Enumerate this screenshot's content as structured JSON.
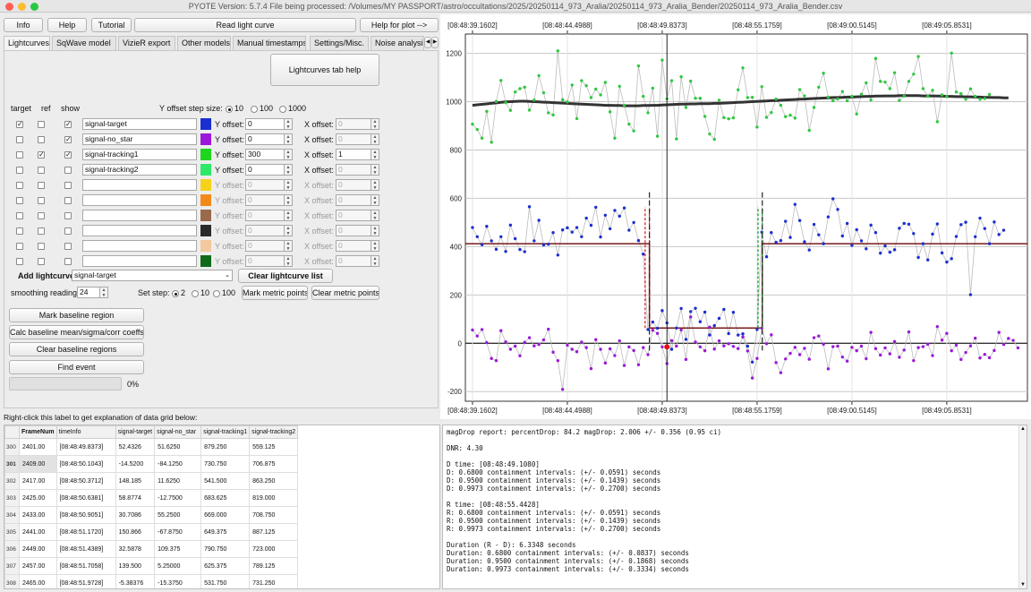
{
  "window": {
    "title": "PYOTE Version: 5.7.4  File being processed: /Volumes/MY PASSPORT/astro/occultations/2025/20250114_973_Aralia/20250114_973_Aralia_Bender/20250114_973_Aralia_Bender.csv"
  },
  "toolbar": {
    "info": "Info",
    "help": "Help",
    "tutorial": "Tutorial",
    "read_light_curve": "Read light curve",
    "help_for_plot": "Help for plot -->"
  },
  "tabs": [
    {
      "label": "Lightcurves",
      "active": true
    },
    {
      "label": "SqWave model",
      "active": false
    },
    {
      "label": "VizieR export",
      "active": false
    },
    {
      "label": "Other models",
      "active": false
    },
    {
      "label": "Manual timestamps",
      "active": false
    },
    {
      "label": "Settings/Misc.",
      "active": false
    },
    {
      "label": "Noise analysis/",
      "active": false
    }
  ],
  "tab_scroll": {
    "left": "◀",
    "right": "▶"
  },
  "lightcurves": {
    "tab_help": "Lightcurves tab help",
    "y_step_label": "Y offset step size:",
    "y_step_options": [
      "10",
      "100",
      "1000"
    ],
    "y_step_selected": "10",
    "headers": {
      "target": "target",
      "ref": "ref",
      "show": "show"
    },
    "y_offset_label": "Y offset:",
    "x_offset_label": "X offset:",
    "rows": [
      {
        "name": "signal-target",
        "color": "#1a2fd0",
        "target": true,
        "ref": false,
        "show": true,
        "y": "0",
        "x": "0",
        "enabled": true,
        "x_enabled": false
      },
      {
        "name": "signal-no_star",
        "color": "#9b18d8",
        "target": false,
        "ref": false,
        "show": true,
        "y": "0",
        "x": "0",
        "enabled": true,
        "x_enabled": false
      },
      {
        "name": "signal-tracking1",
        "color": "#1fd51f",
        "target": false,
        "ref": true,
        "show": true,
        "y": "300",
        "x": "1",
        "enabled": true,
        "x_enabled": true
      },
      {
        "name": "signal-tracking2",
        "color": "#2ee86a",
        "target": false,
        "ref": false,
        "show": false,
        "y": "0",
        "x": "0",
        "enabled": true,
        "x_enabled": false
      },
      {
        "name": "",
        "color": "#f6d21a",
        "target": false,
        "ref": false,
        "show": false,
        "y": "0",
        "x": "0",
        "enabled": false,
        "x_enabled": false
      },
      {
        "name": "",
        "color": "#f28a1a",
        "target": false,
        "ref": false,
        "show": false,
        "y": "0",
        "x": "0",
        "enabled": false,
        "x_enabled": false
      },
      {
        "name": "",
        "color": "#9b6a4b",
        "target": false,
        "ref": false,
        "show": false,
        "y": "0",
        "x": "0",
        "enabled": false,
        "x_enabled": false
      },
      {
        "name": "",
        "color": "#2a2a2a",
        "target": false,
        "ref": false,
        "show": false,
        "y": "0",
        "x": "0",
        "enabled": false,
        "x_enabled": false
      },
      {
        "name": "",
        "color": "#f4c89c",
        "target": false,
        "ref": false,
        "show": false,
        "y": "0",
        "x": "0",
        "enabled": false,
        "x_enabled": false
      },
      {
        "name": "",
        "color": "#0f6a1a",
        "target": false,
        "ref": false,
        "show": false,
        "y": "0",
        "x": "0",
        "enabled": false,
        "x_enabled": false
      }
    ],
    "add_lightcurve_label": "Add lightcurve",
    "add_lightcurve_value": "signal-target",
    "clear_list": "Clear lightcurve list",
    "smoothing_label": "smoothing readings",
    "smoothing_value": "24",
    "set_step_label": "Set step:",
    "set_step_options": [
      "2",
      "10",
      "100"
    ],
    "set_step_selected": "2",
    "mark_metric": "Mark metric points",
    "clear_metric": "Clear metric points",
    "mark_baseline": "Mark baseline region",
    "calc_baseline": "Calc baseline mean/sigma/corr coeffs",
    "clear_baseline": "Clear baseline regions",
    "find_event": "Find event",
    "progress": "0%",
    "progress_value": 0
  },
  "grid_hint": "Right-click this label to get explanation of data grid below:",
  "grid": {
    "columns": [
      "FrameNum",
      "timeInfo",
      "signal-target",
      "signal-no_star",
      "signal-tracking1",
      "signal-tracking2"
    ],
    "rows": [
      {
        "idx": "300",
        "cells": [
          "2401.00",
          "[08:48:49.8373]",
          "52.4326",
          "51.6250",
          "879.250",
          "559.125"
        ]
      },
      {
        "idx": "301",
        "cells": [
          "2409.00",
          "[08:48:50.1043]",
          "-14.5200",
          "-84.1250",
          "730.750",
          "706.875"
        ],
        "selected": true
      },
      {
        "idx": "302",
        "cells": [
          "2417.00",
          "[08:48:50.3712]",
          "148.185",
          "11.6250",
          "541.500",
          "863.250"
        ]
      },
      {
        "idx": "303",
        "cells": [
          "2425.00",
          "[08:48:50.6381]",
          "58.8774",
          "-12.7500",
          "683.625",
          "819.000"
        ]
      },
      {
        "idx": "304",
        "cells": [
          "2433.00",
          "[08:48:50.9051]",
          "30.7086",
          "55.2500",
          "669.000",
          "708.750"
        ]
      },
      {
        "idx": "305",
        "cells": [
          "2441.00",
          "[08:48:51.1720]",
          "150.866",
          "-67.8750",
          "649.375",
          "887.125"
        ]
      },
      {
        "idx": "306",
        "cells": [
          "2449.00",
          "[08:48:51.4389]",
          "32.5878",
          "109.375",
          "790.750",
          "723.000"
        ]
      },
      {
        "idx": "307",
        "cells": [
          "2457.00",
          "[08:48:51.7058]",
          "139.500",
          "5.25000",
          "625.375",
          "789.125"
        ]
      },
      {
        "idx": "308",
        "cells": [
          "2465.00",
          "[08:48:51.9728]",
          "-5.38376",
          "-15.3750",
          "531.750",
          "731.250"
        ]
      }
    ]
  },
  "report_lines": [
    "magDrop report: percentDrop: 84.2 magDrop: 2.006 +/- 0.356 (0.95 ci)",
    "",
    "DNR: 4.30",
    "",
    "D time: [08:48:49.1080]",
    "D: 0.6800 containment intervals: (+/- 0.0591) seconds",
    "D: 0.9500 containment intervals: (+/- 0.1439) seconds",
    "D: 0.9973 containment intervals: (+/- 0.2700) seconds",
    "",
    "R time: [08:48:55.4428]",
    "R: 0.6800 containment intervals: (+/- 0.0591) seconds",
    "R: 0.9500 containment intervals: (+/- 0.1439) seconds",
    "R: 0.9973 containment intervals: (+/- 0.2700) seconds",
    "",
    "Duration (R - D): 6.3348 seconds",
    "Duration: 0.6800 containment intervals: (+/- 0.0837) seconds",
    "Duration: 0.9500 containment intervals: (+/- 0.1868) seconds",
    "Duration: 0.9973 containment intervals: (+/- 0.3334) seconds"
  ],
  "chart_data": {
    "type": "scatter",
    "title": "",
    "xlabel": "",
    "ylabel": "",
    "grid": true,
    "x_tick_labels": [
      "[08:48:39.1602]",
      "[08:48:44.4988]",
      "[08:48:49.8373]",
      "[08:48:55.1759]",
      "[08:49:00.5145]",
      "[08:49:05.8531]"
    ],
    "x_ticks_frame": [
      0,
      20,
      40,
      60,
      80,
      100
    ],
    "xlim_frame": [
      -1.5,
      117
    ],
    "y_ticks": [
      -200,
      0,
      200,
      400,
      600,
      800,
      1000,
      1200
    ],
    "ylim": [
      -240,
      1280
    ],
    "cursor_frame": 41,
    "cursor_marker": {
      "frame": 41,
      "value": -15
    },
    "event": {
      "d_frame": 37.3,
      "r_frame": 61.1,
      "baseline": 412,
      "bottom": 63,
      "d_lines": [
        36.4,
        37.3
      ],
      "r_lines": [
        60.2,
        61.1
      ],
      "d_color": "#d01818",
      "r_color": "#0e9a2a"
    },
    "model_color": "#7a1a1a",
    "smooth_color": "#333333",
    "series": [
      {
        "name": "signal-tracking1",
        "color": "#2fc83f",
        "line_color": "#bbbbbb",
        "values": [
          907,
          885,
          849,
          960,
          832,
          1001,
          1088,
          996,
          964,
          1040,
          1054,
          1060,
          965,
          1007,
          1108,
          1037,
          954,
          945,
          1210,
          1008,
          999,
          1069,
          930,
          1087,
          1066,
          1017,
          1052,
          1028,
          1080,
          958,
          849,
          1064,
          985,
          907,
          879,
          1148,
          1022,
          954,
          1056,
          857,
          1172,
          1012,
          1087,
          846,
          1103,
          976,
          1085,
          1014,
          1014,
          939,
          866,
          844,
          1006,
          934,
          929,
          933,
          1049,
          1140,
          1017,
          1018,
          895,
          1062,
          935,
          955,
          1011,
          985,
          938,
          944,
          932,
          1050,
          1024,
          881,
          976,
          1060,
          1118,
          1019,
          1004,
          1011,
          1042,
          1004,
          1022,
          949,
          1031,
          1078,
          1007,
          1179,
          1084,
          1081,
          1054,
          1120,
          1005,
          1023,
          1084,
          1114,
          1187,
          1054,
          1022,
          1047,
          917,
          1028,
          1021,
          1201,
          1040,
          1033,
          1010,
          1053,
          1022,
          1010,
          1013,
          1030
        ]
      },
      {
        "name": "signal-target",
        "color": "#1a2fd0",
        "line_color": "#bbbbbb",
        "values": [
          479,
          441,
          408,
          484,
          424,
          389,
          441,
          380,
          489,
          433,
          388,
          379,
          565,
          424,
          509,
          407,
          410,
          458,
          365,
          469,
          478,
          460,
          479,
          441,
          518,
          488,
          563,
          440,
          530,
          474,
          550,
          526,
          560,
          468,
          500,
          425,
          369,
          57,
          88,
          62,
          135,
          84,
          -25,
          63,
          144,
          16,
          131,
          145,
          89,
          129,
          34,
          73,
          103,
          140,
          40,
          128,
          34,
          39,
          -12,
          -78,
          57,
          460,
          358,
          458,
          418,
          425,
          505,
          438,
          575,
          508,
          420,
          386,
          492,
          449,
          412,
          523,
          598,
          554,
          444,
          496,
          405,
          470,
          424,
          391,
          489,
          458,
          373,
          403,
          377,
          387,
          476,
          496,
          493,
          454,
          355,
          412,
          345,
          452,
          494,
          374,
          336,
          350,
          442,
          491,
          501,
          201,
          441,
          518,
          475,
          412,
          502,
          450,
          468
        ]
      },
      {
        "name": "signal-no_star",
        "color": "#9b18d8",
        "line_color": "#bbbbbb",
        "values": [
          55,
          30,
          57,
          3,
          -63,
          -72,
          52,
          6,
          -25,
          -12,
          -52,
          4,
          23,
          -11,
          -5,
          14,
          58,
          -37,
          -72,
          -191,
          -8,
          -25,
          -35,
          5,
          -18,
          -105,
          15,
          -25,
          -82,
          -23,
          -51,
          10,
          -92,
          -15,
          -30,
          -89,
          -18,
          -47,
          54,
          41,
          -15,
          -84,
          11,
          -12,
          55,
          -67,
          109,
          5,
          -15,
          -31,
          67,
          -24,
          10,
          -11,
          -2,
          -13,
          -22,
          26,
          -32,
          -144,
          -63,
          63,
          -2,
          35,
          -80,
          -122,
          -65,
          -42,
          -17,
          -47,
          -21,
          -66,
          23,
          30,
          -4,
          -106,
          -14,
          -12,
          -57,
          -74,
          -17,
          -31,
          -12,
          -64,
          45,
          -22,
          -49,
          -19,
          -44,
          7,
          -58,
          -28,
          47,
          -72,
          -18,
          -14,
          -4,
          -51,
          69,
          13,
          41,
          -31,
          -8,
          -67,
          -38,
          -11,
          21,
          -61,
          -46,
          -60,
          -30,
          45,
          -5,
          20,
          12,
          -19
        ]
      },
      {
        "name": "smoothed-tracking1",
        "color": "#333333",
        "values": [
          985,
          987,
          989,
          991,
          993,
          995,
          997,
          999,
          1000,
          1001,
          1002,
          1002,
          1001,
          1000,
          999,
          998,
          997,
          996,
          995,
          994,
          993,
          992,
          991,
          990,
          989,
          988,
          987,
          986,
          985,
          985,
          984,
          984,
          983,
          983,
          983,
          983,
          984,
          984,
          985,
          985,
          986,
          987,
          988,
          989,
          990,
          990,
          991,
          991,
          992,
          992,
          992,
          993,
          993,
          994,
          995,
          996,
          997,
          998,
          999,
          1000,
          1001,
          1002,
          1003,
          1004,
          1005,
          1006,
          1007,
          1008,
          1009,
          1010,
          1011,
          1012,
          1013,
          1014,
          1015,
          1016,
          1017,
          1017,
          1018,
          1019,
          1019,
          1020,
          1021,
          1022,
          1022,
          1023,
          1023,
          1024,
          1024,
          1024,
          1025,
          1025,
          1025,
          1025,
          1025,
          1024,
          1024,
          1024,
          1023,
          1023,
          1022,
          1022,
          1021,
          1021,
          1020,
          1020,
          1019,
          1019,
          1018,
          1018,
          1017,
          1017,
          1016,
          1016
        ]
      }
    ]
  }
}
